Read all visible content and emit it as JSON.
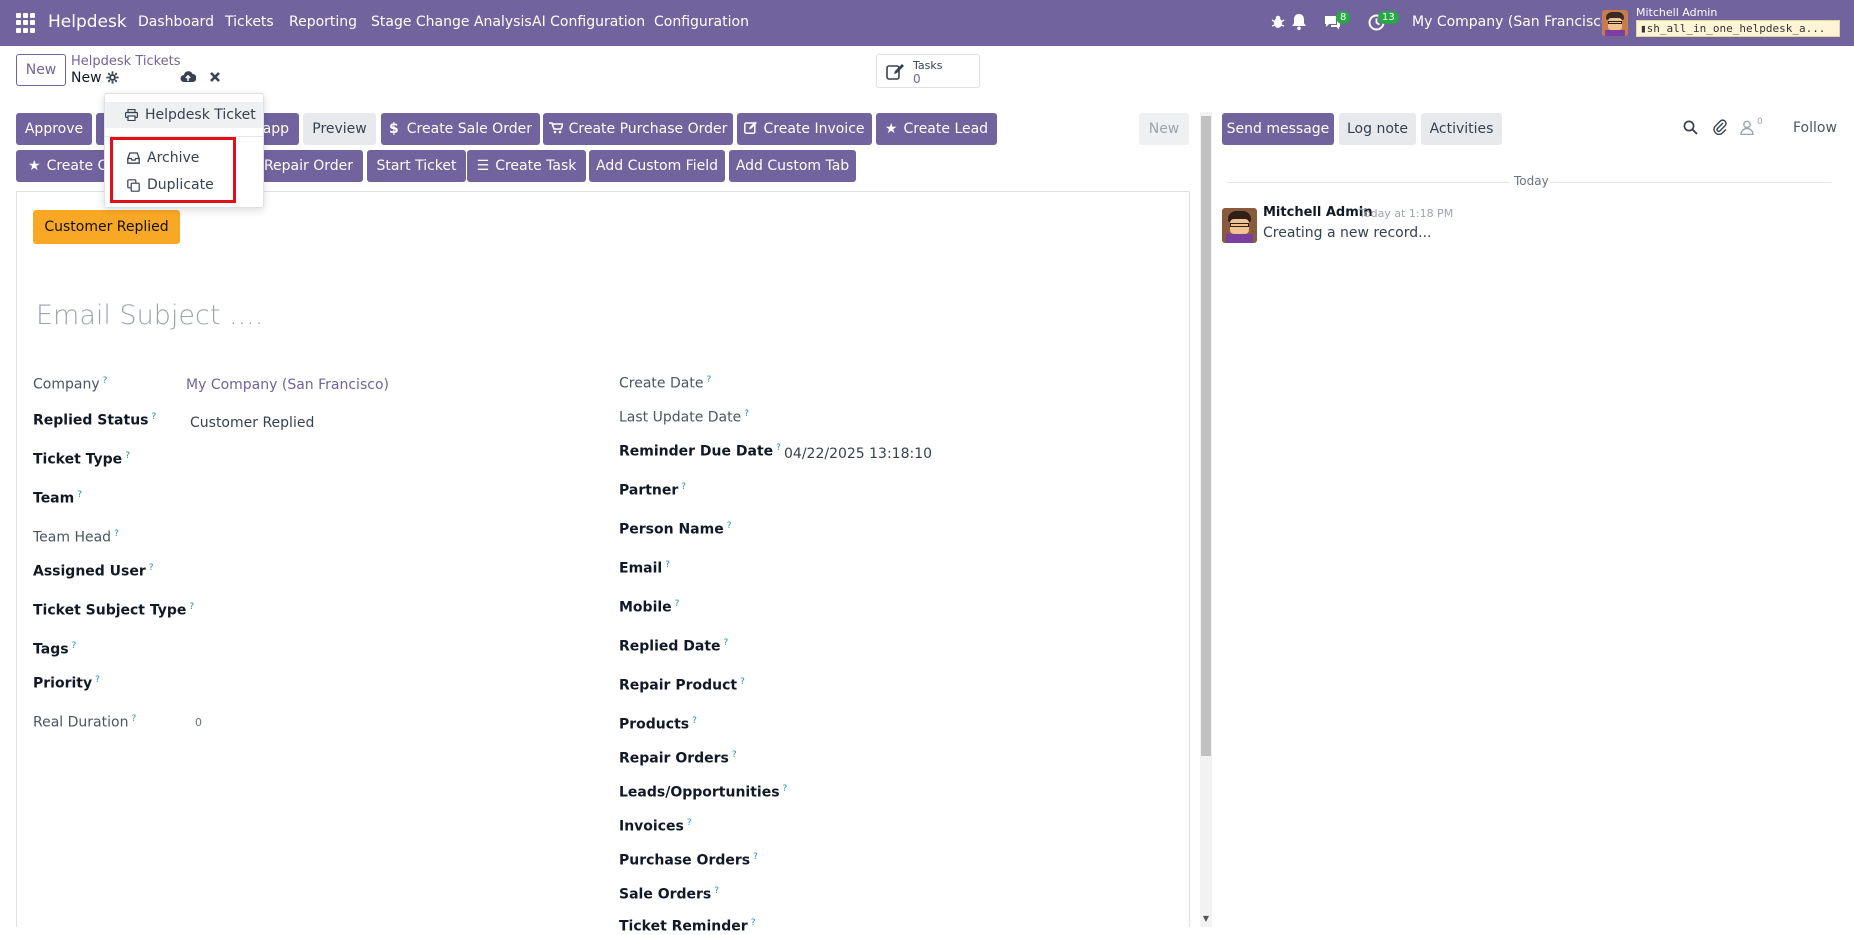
{
  "navbar": {
    "brand": "Helpdesk",
    "menu": [
      "Dashboard",
      "Tickets",
      "Reporting",
      "Stage Change Analysis",
      "AI Configuration",
      "Configuration"
    ],
    "messages_badge": "8",
    "activities_badge": "13",
    "company": "My Company (San Francisco)",
    "user_name": "Mitchell Admin",
    "database": "sh_all_in_one_helpdesk_a..."
  },
  "control": {
    "new_label": "New",
    "breadcrumb_parent": "Helpdesk Tickets",
    "breadcrumb_current": "New",
    "tasks_label": "Tasks",
    "tasks_count": "0"
  },
  "dropdown": {
    "print_item": "Helpdesk Ticket",
    "archive_item": "Archive",
    "duplicate_item": "Duplicate"
  },
  "buttons_row1": {
    "approve": "Approve",
    "whatsapp_tail": "app",
    "preview": "Preview",
    "create_sale_order": "Create Sale Order",
    "create_purchase_order": "Create Purchase Order",
    "create_invoice": "Create Invoice",
    "create_lead": "Create Lead"
  },
  "buttons_row2": {
    "create_c": "Create C",
    "repair_order": "Repair Order",
    "start_ticket": "Start Ticket",
    "create_task": "Create Task",
    "add_custom_field": "Add Custom Field",
    "add_custom_tab": "Add Custom Tab"
  },
  "stage": "New",
  "form": {
    "status_badge": "Customer Replied",
    "subject_placeholder": "Email Subject ....",
    "left": {
      "company": {
        "label": "Company",
        "value": "My Company (San Francisco)"
      },
      "replied_status": {
        "label": "Replied Status",
        "value": "Customer Replied"
      },
      "ticket_type": {
        "label": "Ticket Type"
      },
      "team": {
        "label": "Team"
      },
      "team_head": {
        "label": "Team Head"
      },
      "assigned_user": {
        "label": "Assigned User"
      },
      "ticket_subject_type": {
        "label": "Ticket Subject Type"
      },
      "tags": {
        "label": "Tags"
      },
      "priority": {
        "label": "Priority"
      },
      "real_duration": {
        "label": "Real Duration",
        "value": "0"
      }
    },
    "right": {
      "create_date": {
        "label": "Create Date"
      },
      "last_update_date": {
        "label": "Last Update Date"
      },
      "reminder_due_date": {
        "label": "Reminder Due Date",
        "value": "04/22/2025 13:18:10"
      },
      "partner": {
        "label": "Partner"
      },
      "person_name": {
        "label": "Person Name"
      },
      "email": {
        "label": "Email"
      },
      "mobile": {
        "label": "Mobile"
      },
      "replied_date": {
        "label": "Replied Date"
      },
      "repair_product": {
        "label": "Repair Product"
      },
      "products": {
        "label": "Products"
      },
      "repair_orders": {
        "label": "Repair Orders"
      },
      "leads": {
        "label": "Leads/Opportunities"
      },
      "invoices": {
        "label": "Invoices"
      },
      "purchase_orders": {
        "label": "Purchase Orders"
      },
      "sale_orders": {
        "label": "Sale Orders"
      },
      "ticket_reminder": {
        "label": "Ticket Reminder"
      }
    }
  },
  "chatter": {
    "send_message": "Send message",
    "log_note": "Log note",
    "activities": "Activities",
    "followers_count": "0",
    "follow": "Follow",
    "date_separator": "Today",
    "message": {
      "author": "Mitchell Admin",
      "time": "Today at 1:18 PM",
      "body": "Creating a new record..."
    }
  },
  "colors": {
    "brand": "#71639e",
    "warning": "#f9a825",
    "highlight": "#e3101a"
  }
}
